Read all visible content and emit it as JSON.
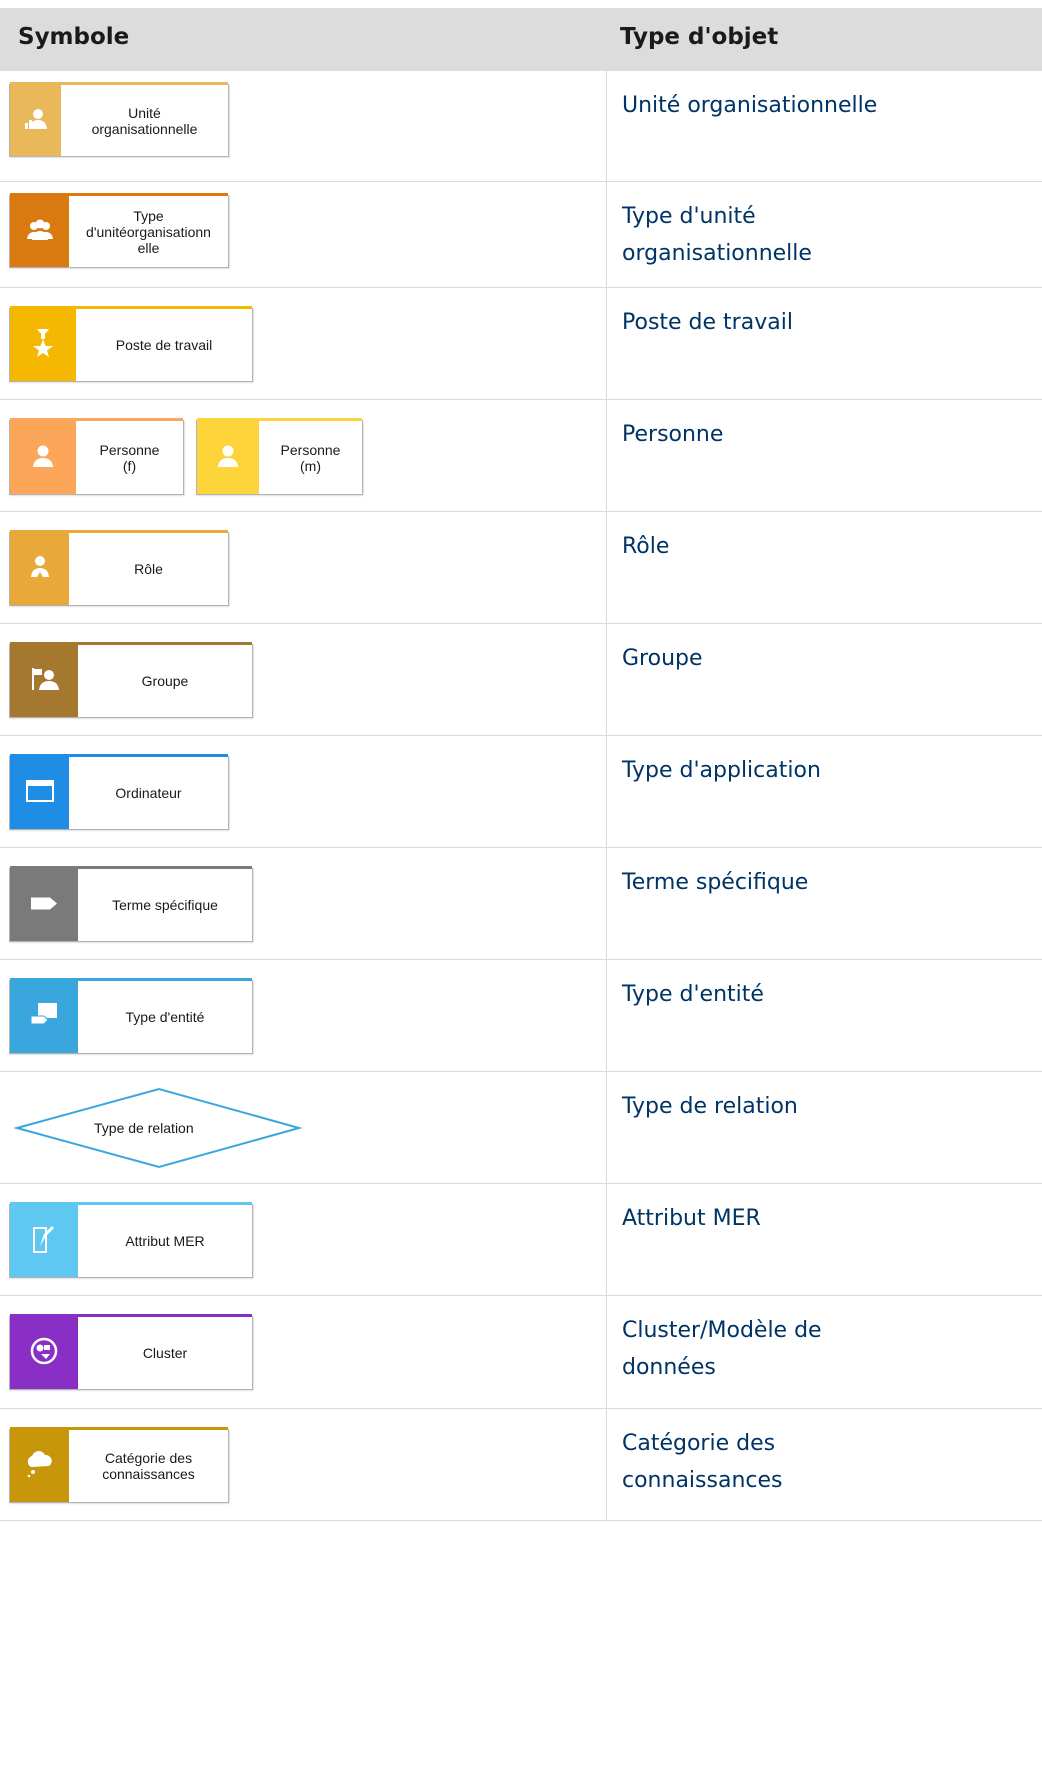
{
  "header": {
    "col_symbol": "Symbole",
    "col_type": "Type d'objet"
  },
  "rows": [
    {
      "type": "Unité organisationnelle",
      "shapes": [
        {
          "label": "Unité organisationnelle",
          "label_lines": [
            "Unité",
            "organisationnelle"
          ],
          "color": "#e8b85a",
          "icon": "org-unit-icon"
        }
      ]
    },
    {
      "type": "Type d'unité organisationnelle",
      "shapes": [
        {
          "label": "Type d'unitéorganisationnelle",
          "label_lines": [
            "Type",
            "d'unitéorganisationn",
            "elle"
          ],
          "color": "#d97a10",
          "icon": "org-unit-type-icon"
        }
      ]
    },
    {
      "type": "Poste de travail",
      "shapes": [
        {
          "label": "Poste de travail",
          "label_lines": [
            "Poste de travail"
          ],
          "color": "#f5b800",
          "icon": "position-icon"
        }
      ]
    },
    {
      "type": "Personne",
      "shapes": [
        {
          "label": "Personne (f)",
          "label_lines": [
            "Personne",
            "(f)"
          ],
          "color": "#fca65a",
          "icon": "person-icon"
        },
        {
          "label": "Personne (m)",
          "label_lines": [
            "Personne",
            "(m)"
          ],
          "color": "#fdd43a",
          "icon": "person-icon"
        }
      ]
    },
    {
      "type": "Rôle",
      "shapes": [
        {
          "label": "Rôle",
          "label_lines": [
            "Rôle"
          ],
          "color": "#e8a83a",
          "icon": "role-icon"
        }
      ]
    },
    {
      "type": "Groupe",
      "shapes": [
        {
          "label": "Groupe",
          "label_lines": [
            "Groupe"
          ],
          "color": "#a4782e",
          "icon": "group-icon"
        }
      ]
    },
    {
      "type": "Type d'application",
      "shapes": [
        {
          "label": "Ordinateur",
          "label_lines": [
            "Ordinateur"
          ],
          "color": "#1f8de6",
          "icon": "application-window-icon"
        }
      ]
    },
    {
      "type": "Terme spécifique",
      "shapes": [
        {
          "label": "Terme spécifique",
          "label_lines": [
            "Terme spécifique"
          ],
          "color": "#7a7a7a",
          "icon": "tag-icon"
        }
      ]
    },
    {
      "type": "Type d'entité",
      "shapes": [
        {
          "label": "Type d'entité",
          "label_lines": [
            "Type d'entité"
          ],
          "color": "#3aa6de",
          "icon": "entity-type-icon"
        }
      ]
    },
    {
      "type": "Type de relation",
      "shapes": [
        {
          "label": "Type de relation",
          "label_lines": [
            "Type de relation"
          ],
          "color": "#3aa6de",
          "icon": ""
        }
      ]
    },
    {
      "type": "Attribut MER",
      "shapes": [
        {
          "label": "Attribut MER",
          "label_lines": [
            "Attribut MER"
          ],
          "color": "#5ec8f2",
          "icon": "attribute-pen-icon"
        }
      ]
    },
    {
      "type": "Cluster/Modèle de données",
      "shapes": [
        {
          "label": "Cluster",
          "label_lines": [
            "Cluster"
          ],
          "color": "#8a2fc6",
          "icon": "cluster-icon"
        }
      ]
    },
    {
      "type": "Catégorie des connaissances",
      "shapes": [
        {
          "label": "Catégorie des connaissances",
          "label_lines": [
            "Catégorie des",
            "connaissances"
          ],
          "color": "#c8960a",
          "icon": "knowledge-cloud-icon"
        }
      ]
    }
  ]
}
